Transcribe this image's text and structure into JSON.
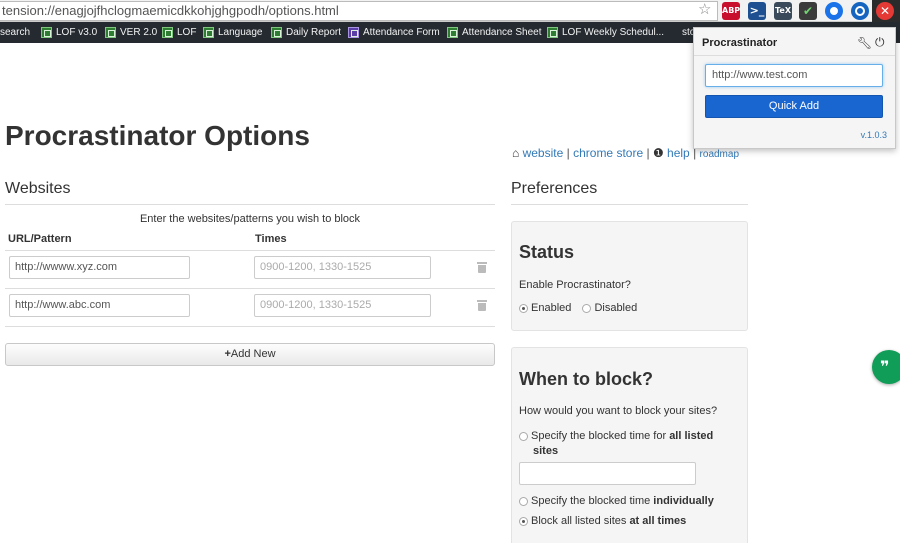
{
  "browser": {
    "url": "tension://enagjojfhclogmaemicdkkohjghgpodh/options.html",
    "extensions": [
      "star-icon",
      "abp-icon",
      "powershell-icon",
      "tex-icon",
      "checkbox-icon",
      "chrome-icon",
      "clock-icon",
      "procrastinator-icon"
    ],
    "abp_label": "ABP",
    "tex_label": "TeX"
  },
  "bookmarks": [
    {
      "label": "search"
    },
    {
      "label": "LOF v3.0"
    },
    {
      "label": "VER 2.0"
    },
    {
      "label": "LOF"
    },
    {
      "label": "Language"
    },
    {
      "label": "Daily Report"
    },
    {
      "label": "Attendance Form"
    },
    {
      "label": "Attendance Sheet"
    },
    {
      "label": "LOF Weekly Schedul..."
    },
    {
      "label": "sto"
    }
  ],
  "page": {
    "title": "Procrastinator Options",
    "links": {
      "website": "website",
      "sep1": "|",
      "chrome_store": "chrome store",
      "sep2": "|",
      "help": "help",
      "sep3": "|",
      "roadmap": "roadmap"
    }
  },
  "websites": {
    "heading": "Websites",
    "caption": "Enter the websites/patterns you wish to block",
    "col_url": "URL/Pattern",
    "col_times": "Times",
    "rows": [
      {
        "url": "http://wwww.xyz.com",
        "times_placeholder": "0900-1200, 1330-1525"
      },
      {
        "url": "http://www.abc.com",
        "times_placeholder": "0900-1200, 1330-1525"
      }
    ],
    "add_new": "Add New",
    "add_icon": "+"
  },
  "preferences": {
    "heading": "Preferences",
    "status": {
      "title": "Status",
      "question": "Enable Procrastinator?",
      "options": [
        "Enabled",
        "Disabled"
      ],
      "selected": "Enabled"
    },
    "when": {
      "title": "When to block?",
      "question": "How would you want to block your sites?",
      "opt1_prefix": "Specify the blocked time for ",
      "opt1_bold": "all listed",
      "opt1_bold2": "sites",
      "opt2_prefix": "Specify the blocked time ",
      "opt2_bold": "individually",
      "opt3_prefix": "Block all listed sites ",
      "opt3_bold": "at all times",
      "selected": "at all times"
    }
  },
  "popup": {
    "title": "Procrastinator",
    "input_value": "http://www.test.com",
    "button": "Quick Add",
    "version": "v.1.0.3"
  },
  "colors": {
    "primary": "#1a66d1",
    "link": "#337ab7",
    "bookmark_bar": "#252a30",
    "fab": "#0f9d58"
  }
}
